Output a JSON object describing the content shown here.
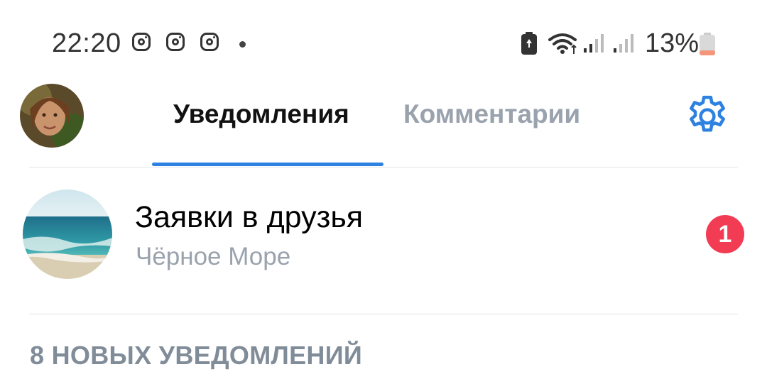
{
  "status_bar": {
    "time": "22:20",
    "battery_percent": "13%",
    "notification_icons": [
      "instagram-icon",
      "instagram-icon",
      "instagram-icon"
    ],
    "battery_level": 0.13,
    "colors": {
      "battery_low": "#f5957a"
    }
  },
  "header": {
    "tabs": [
      {
        "label": "Уведомления",
        "active": true
      },
      {
        "label": "Комментарии",
        "active": false
      }
    ],
    "accent_color": "#2d81e0",
    "settings_icon": "gear-icon"
  },
  "friend_requests": {
    "title": "Заявки в друзья",
    "subtitle": "Чёрное Море",
    "badge_count": "1",
    "badge_color": "#f23c54"
  },
  "notifications_section": {
    "header": "8 НОВЫХ УВЕДОМЛЕНИЙ"
  }
}
